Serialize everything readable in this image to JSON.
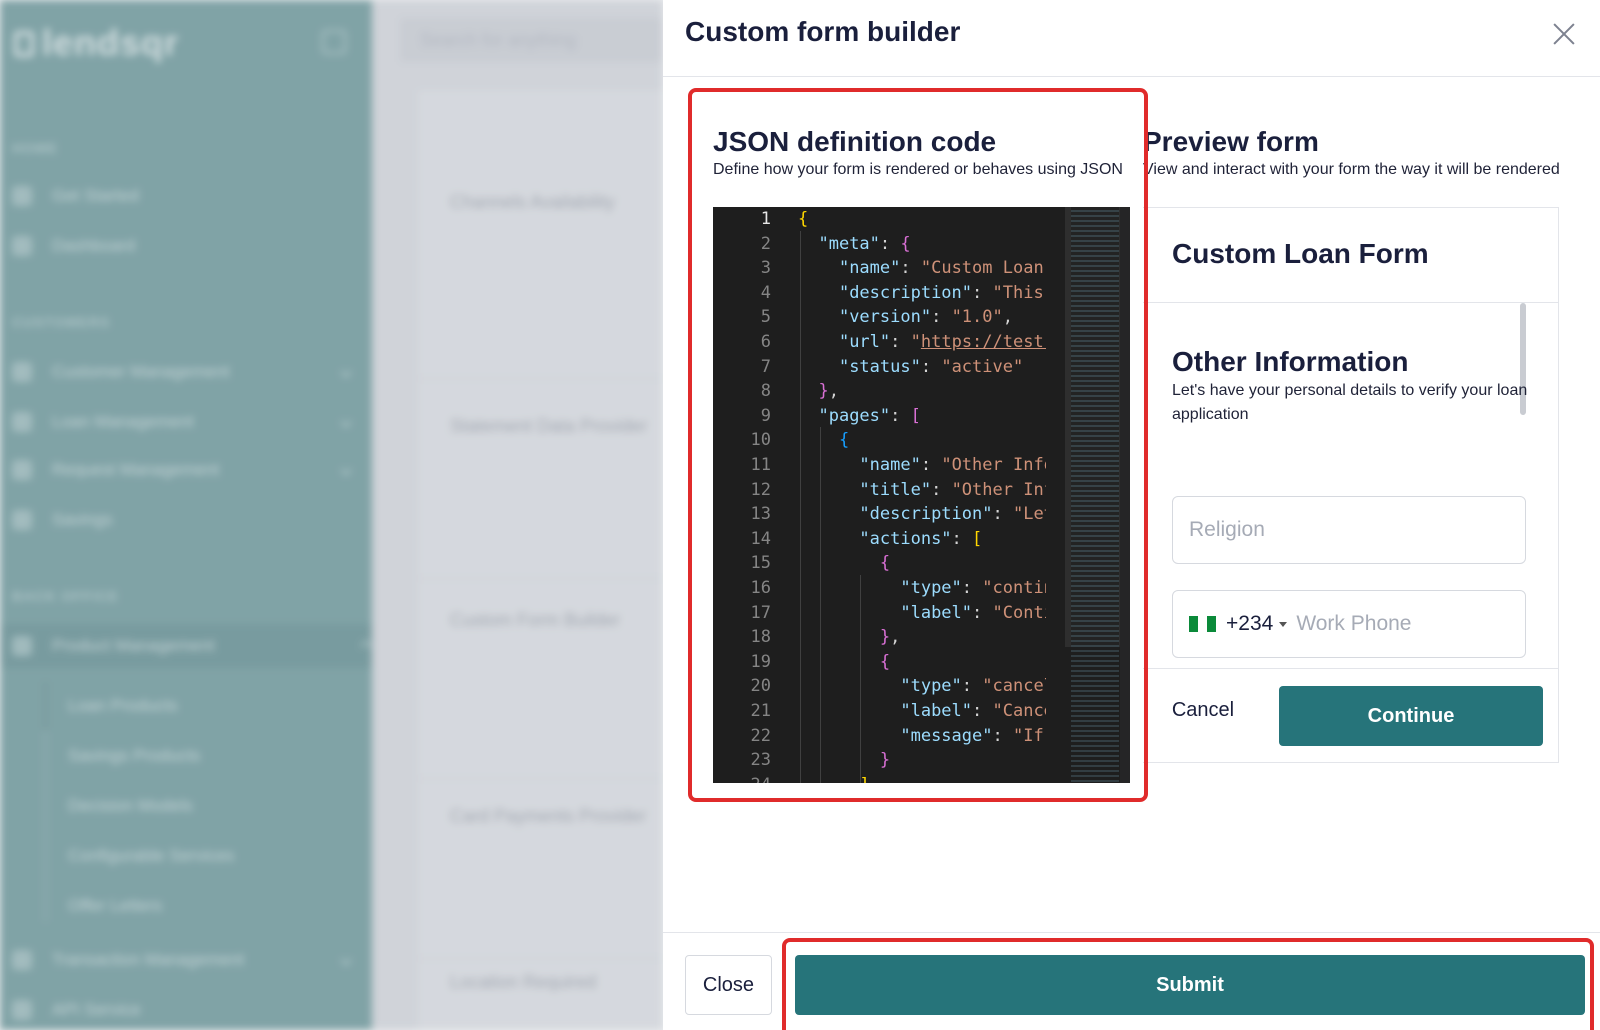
{
  "background": {
    "logo": "lendsqr",
    "search_placeholder": "Search for anything",
    "sidebar": {
      "sections": [
        "HOME",
        "CUSTOMERS",
        "BACK OFFICE"
      ],
      "home_items": [
        "Get Started",
        "Dashboard"
      ],
      "customer_items": [
        "Customer Management",
        "Loan Management",
        "Request Management",
        "Savings"
      ],
      "backoffice_items": [
        "Product Management"
      ],
      "product_sub_items": [
        "Loan Products",
        "Savings Products",
        "Decision Models",
        "Configurable Services",
        "Offer Letters"
      ],
      "bottom_items": [
        "Transaction Management",
        "API Service"
      ]
    },
    "cards": [
      "Channels Availability",
      "Statement Data Provider",
      "Custom Form Builder",
      "Card Payments Provider",
      "Location Required"
    ]
  },
  "modal": {
    "title": "Custom form builder",
    "json_panel": {
      "title": "JSON definition code",
      "description": "Define how your form is rendered or behaves using JSON"
    },
    "editor": {
      "lines": [
        {
          "n": "1",
          "html": "<span class=\"y\">{</span>"
        },
        {
          "n": "2",
          "html": "  <span class=\"k\">\"meta\"</span>: <span class=\"m\">{</span>"
        },
        {
          "n": "3",
          "html": "    <span class=\"k\">\"name\"</span>: <span class=\"s\">\"Custom Loan Form\"</span>,"
        },
        {
          "n": "4",
          "html": "    <span class=\"k\">\"description\"</span>: <span class=\"s\">\"This is</span>"
        },
        {
          "n": "5",
          "html": "    <span class=\"k\">\"version\"</span>: <span class=\"s\">\"1.0\"</span>,"
        },
        {
          "n": "6",
          "html": "    <span class=\"k\">\"url\"</span>: <span class=\"s\">\"</span><span class=\"u\">https://test.ls</span>"
        },
        {
          "n": "7",
          "html": "    <span class=\"k\">\"status\"</span>: <span class=\"s\">\"active\"</span>"
        },
        {
          "n": "8",
          "html": "  <span class=\"m\">}</span>,"
        },
        {
          "n": "9",
          "html": "  <span class=\"k\">\"pages\"</span>: <span class=\"m\">[</span>"
        },
        {
          "n": "10",
          "html": "    <span class=\"b\">{</span>"
        },
        {
          "n": "11",
          "html": "      <span class=\"k\">\"name\"</span>: <span class=\"s\">\"Other Inform</span>"
        },
        {
          "n": "12",
          "html": "      <span class=\"k\">\"title\"</span>: <span class=\"s\">\"Other Infor</span>"
        },
        {
          "n": "13",
          "html": "      <span class=\"k\">\"description\"</span>: <span class=\"s\">\"Let's</span>"
        },
        {
          "n": "14",
          "html": "      <span class=\"k\">\"actions\"</span>: <span class=\"y\">[</span>"
        },
        {
          "n": "15",
          "html": "        <span class=\"m\">{</span>"
        },
        {
          "n": "16",
          "html": "          <span class=\"k\">\"type\"</span>: <span class=\"s\">\"continue</span>"
        },
        {
          "n": "17",
          "html": "          <span class=\"k\">\"label\"</span>: <span class=\"s\">\"Continu</span>"
        },
        {
          "n": "18",
          "html": "        <span class=\"m\">}</span>,"
        },
        {
          "n": "19",
          "html": "        <span class=\"m\">{</span>"
        },
        {
          "n": "20",
          "html": "          <span class=\"k\">\"type\"</span>: <span class=\"s\">\"cancel\"</span>,"
        },
        {
          "n": "21",
          "html": "          <span class=\"k\">\"label\"</span>: <span class=\"s\">\"Cancel\"</span>"
        },
        {
          "n": "22",
          "html": "          <span class=\"k\">\"message\"</span>: <span class=\"s\">\"If yo</span>"
        },
        {
          "n": "23",
          "html": "        <span class=\"m\">}</span>"
        },
        {
          "n": "24",
          "html": "      <span class=\"y\">]</span>"
        }
      ]
    },
    "preview_panel": {
      "title": "Preview form",
      "description": "View and interact with your form the way it will be rendered"
    },
    "preview": {
      "form_title": "Custom Loan Form",
      "section_title": "Other Information",
      "section_desc": "Let's have your personal details to verify your loan application",
      "religion_placeholder": "Religion",
      "country_code": "+234",
      "phone_placeholder": "Work Phone",
      "cancel_label": "Cancel",
      "continue_label": "Continue"
    },
    "footer": {
      "close_label": "Close",
      "submit_label": "Submit"
    }
  },
  "colors": {
    "primary": "#26747a",
    "highlight": "#e02b2b",
    "sidebar": "#5a8c8e"
  }
}
